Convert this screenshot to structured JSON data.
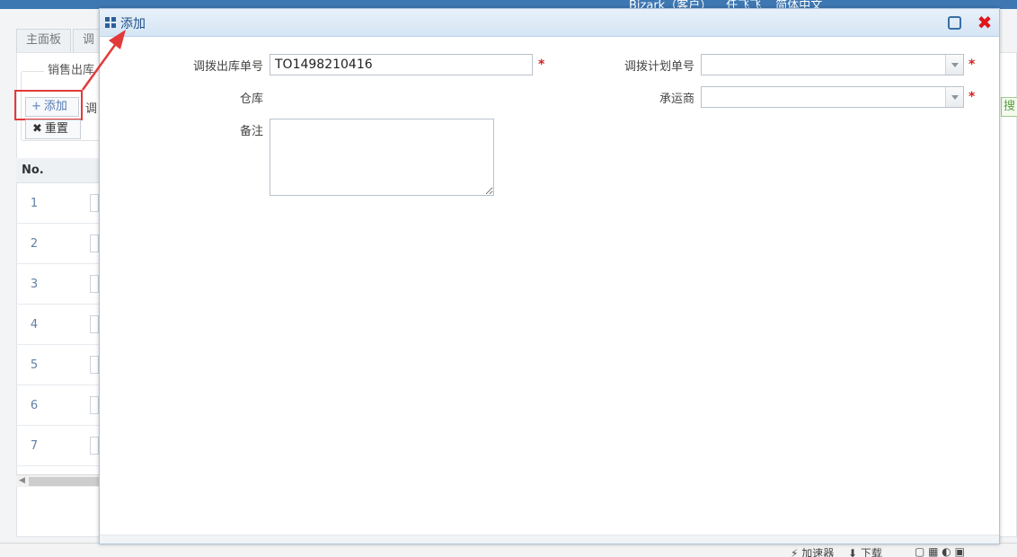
{
  "topbar": {
    "user_company": "Bizark（客户）",
    "user_name": "任飞飞",
    "language": "简体中文"
  },
  "background": {
    "tabs": [
      {
        "label": "主面板"
      },
      {
        "label": "调"
      }
    ],
    "fieldset_legend": "销售出库",
    "add_button": "添加",
    "reset_button": "重置",
    "partial_label": "调",
    "search_button": "搜",
    "grid": {
      "header_no": "No.",
      "rows": [
        "1",
        "2",
        "3",
        "4",
        "5",
        "6",
        "7"
      ]
    }
  },
  "modal": {
    "title": "添加",
    "fields": {
      "transfer_out_no": {
        "label": "调拨出库单号",
        "value": "TO1498210416",
        "required": "*"
      },
      "transfer_plan_no": {
        "label": "调拨计划单号",
        "value": "",
        "required": "*"
      },
      "warehouse": {
        "label": "仓库"
      },
      "carrier": {
        "label": "承运商",
        "value": "",
        "required": "*"
      },
      "remark": {
        "label": "备注",
        "value": ""
      }
    }
  },
  "statusbar": {
    "accelerator": "加速器",
    "download": "下载"
  },
  "colors": {
    "accent": "#3e78b3",
    "highlight": "#e23a3a",
    "required": "#d42020",
    "close": "#e0161b"
  }
}
